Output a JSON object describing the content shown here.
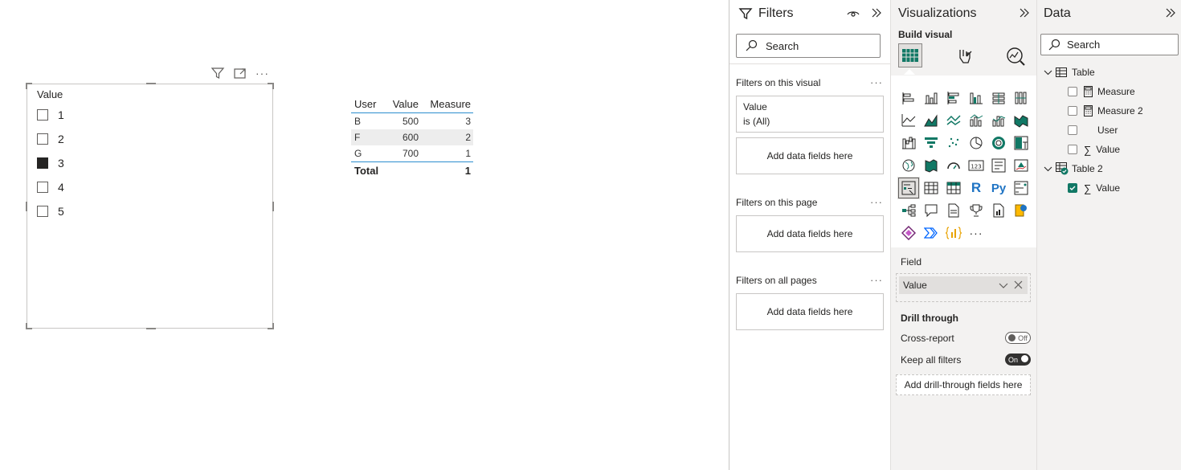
{
  "slicer": {
    "title": "Value",
    "items": [
      {
        "label": "1",
        "checked": false
      },
      {
        "label": "2",
        "checked": false
      },
      {
        "label": "3",
        "checked": true
      },
      {
        "label": "4",
        "checked": false
      },
      {
        "label": "5",
        "checked": false
      }
    ],
    "toolbar": {
      "more": "···"
    }
  },
  "table_visual": {
    "headers": [
      "User",
      "Value",
      "Measure"
    ],
    "rows": [
      [
        "B",
        "500",
        "3"
      ],
      [
        "F",
        "600",
        "2"
      ],
      [
        "G",
        "700",
        "1"
      ]
    ],
    "total": {
      "label": "Total",
      "value": "1"
    }
  },
  "filters": {
    "title": "Filters",
    "search_placeholder": "Search",
    "on_visual": {
      "label": "Filters on this visual",
      "card_field": "Value",
      "card_state": "is (All)",
      "drop": "Add data fields here"
    },
    "on_page": {
      "label": "Filters on this page",
      "drop": "Add data fields here"
    },
    "on_all": {
      "label": "Filters on all pages",
      "drop": "Add data fields here"
    },
    "more": "···"
  },
  "visualizations": {
    "title": "Visualizations",
    "build_visual": "Build visual",
    "field_label": "Field",
    "field_value": "Value",
    "drill_through": "Drill through",
    "cross_report": {
      "label": "Cross-report",
      "state": "Off"
    },
    "keep_filters": {
      "label": "Keep all filters",
      "state": "On"
    },
    "drill_drop": "Add drill-through fields here",
    "r_label": "R",
    "py_label": "Py",
    "more_icon": "···",
    "kpi_number": "123"
  },
  "data": {
    "title": "Data",
    "search_placeholder": "Search",
    "tables": [
      {
        "name": "Table",
        "fields": [
          "Measure",
          "Measure 2",
          "User",
          "Value"
        ]
      },
      {
        "name": "Table 2",
        "fields": [
          "Value"
        ]
      }
    ]
  },
  "colors": {
    "accent": "#117865",
    "table_rule": "#2c8ecf",
    "selected": "#252423"
  }
}
